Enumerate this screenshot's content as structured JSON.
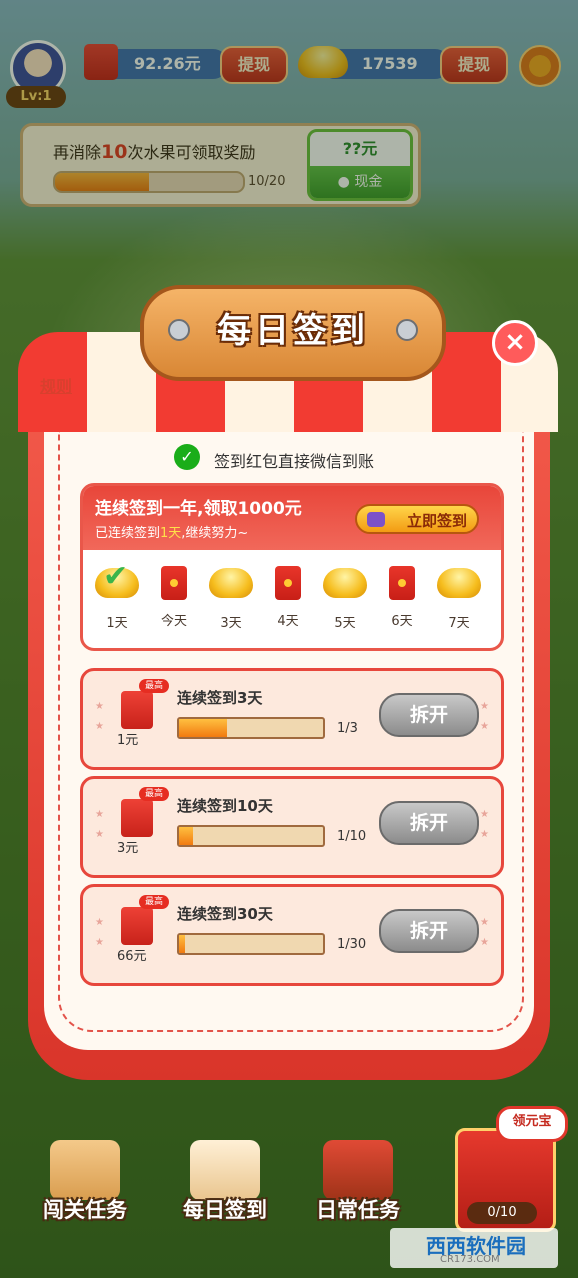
{
  "header": {
    "level": "Lv:1",
    "cash_amount": "92.26元",
    "cash_withdraw": "提现",
    "gold_amount": "17539",
    "gold_withdraw": "提现"
  },
  "task": {
    "title_prefix": "再消除",
    "title_count": "10",
    "title_suffix": "次水果可领取奖励",
    "progress_text": "10/20",
    "progress_ratio": 0.5,
    "reward_amount": "??元",
    "reward_label": "现金"
  },
  "modal": {
    "title": "每日签到",
    "close": "×",
    "rules": "规则",
    "wechat_note": "签到红包直接微信到账",
    "week": {
      "title": "连续签到一年,领取1000元",
      "sub_prefix": "已连续签到",
      "sub_days": "1天",
      "sub_suffix": ",继续努力~",
      "sign_button": "立即签到",
      "days": [
        {
          "label": "1天",
          "icon": "ingot-checked-icon"
        },
        {
          "label": "今天",
          "icon": "red-envelope-icon"
        },
        {
          "label": "3天",
          "icon": "gold-ingot-icon"
        },
        {
          "label": "4天",
          "icon": "red-envelope-icon"
        },
        {
          "label": "5天",
          "icon": "gold-ingot-icon"
        },
        {
          "label": "6天",
          "icon": "red-envelope-icon"
        },
        {
          "label": "7天",
          "icon": "gold-ingot-icon"
        }
      ]
    },
    "rewards": [
      {
        "best": "最高",
        "amount": "1元",
        "title": "连续签到3天",
        "progress": "1/3",
        "ratio": 0.33,
        "button": "拆开"
      },
      {
        "best": "最高",
        "amount": "3元",
        "title": "连续签到10天",
        "progress": "1/10",
        "ratio": 0.1,
        "button": "拆开"
      },
      {
        "best": "最高",
        "amount": "66元",
        "title": "连续签到30天",
        "progress": "1/30",
        "ratio": 0.033,
        "button": "拆开"
      }
    ]
  },
  "bottom_nav": [
    {
      "label": "闯关任务",
      "icon": "map-icon"
    },
    {
      "label": "每日签到",
      "icon": "calendar-icon"
    },
    {
      "label": "日常任务",
      "icon": "treasure-chest-icon"
    }
  ],
  "treasure": {
    "badge": "领元宝",
    "count": "0/10"
  },
  "watermark": {
    "main": "西西软件园",
    "sub": "CR173.COM"
  },
  "colors": {
    "accent_red": "#e8463a",
    "gold": "#f6bd1d",
    "wechat_green": "#1aad19"
  }
}
